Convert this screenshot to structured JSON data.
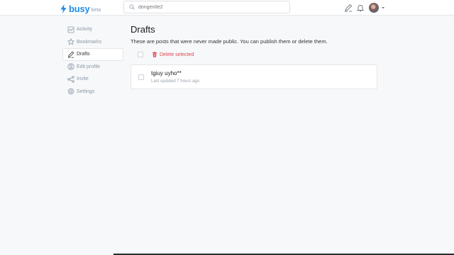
{
  "header": {
    "logo_text": "busy",
    "logo_badge": "beta",
    "search": {
      "value": "dongentle2",
      "placeholder": ""
    },
    "icons": [
      "write-icon",
      "bell-icon",
      "avatar",
      "chevron-down-icon"
    ]
  },
  "sidebar": {
    "items": [
      {
        "label": "Activity",
        "icon": "activity-icon",
        "active": false
      },
      {
        "label": "Bookmarks",
        "icon": "star-icon",
        "active": false
      },
      {
        "label": "Drafts",
        "icon": "write-icon",
        "active": true
      },
      {
        "label": "Edit profile",
        "icon": "user-icon",
        "active": false
      },
      {
        "label": "Invite",
        "icon": "share-icon",
        "active": false
      },
      {
        "label": "Settings",
        "icon": "gear-icon",
        "active": false
      }
    ]
  },
  "main": {
    "title": "Drafts",
    "subtitle": "These are posts that were never made public. You can publish them or delete them.",
    "delete_label": "Delete selected",
    "drafts": [
      {
        "title": "tgiuy uyho**",
        "meta": "Last updated 7 hours ago"
      }
    ]
  },
  "colors": {
    "brand": "#1f8ce6",
    "danger": "#e0454f",
    "background": "#f7f8fa"
  }
}
